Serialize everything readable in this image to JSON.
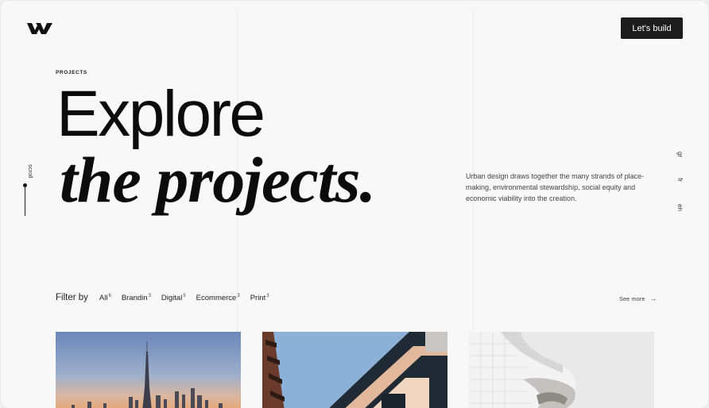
{
  "header": {
    "logo_icon": "w-logo-icon",
    "cta_label": "Let's build"
  },
  "hero": {
    "eyebrow": "PROJECTS",
    "title_line1": "Explore",
    "title_line2": "the projects.",
    "description": "Urban design draws together the many strands of place-making, environmental stewardship, social equity and economic viability into the creation."
  },
  "scroll": {
    "label": "scroll"
  },
  "languages": [
    "gr",
    "fr",
    "en"
  ],
  "filter": {
    "label": "Filter by",
    "items": [
      {
        "label": "All",
        "count": "6"
      },
      {
        "label": "Brandin",
        "count": "3"
      },
      {
        "label": "Digital",
        "count": "5"
      },
      {
        "label": "Ecommerce",
        "count": "3"
      },
      {
        "label": "Print",
        "count": "3"
      }
    ],
    "see_more": "See more",
    "see_more_icon": "arrow-right-icon"
  },
  "projects": [
    {
      "image": "city-skyline-image"
    },
    {
      "image": "building-corner-image"
    },
    {
      "image": "white-architecture-image"
    }
  ],
  "colors": {
    "background": "#f8f8f8",
    "cta_bg": "#1c1c1c",
    "text": "#0c0c0c"
  }
}
